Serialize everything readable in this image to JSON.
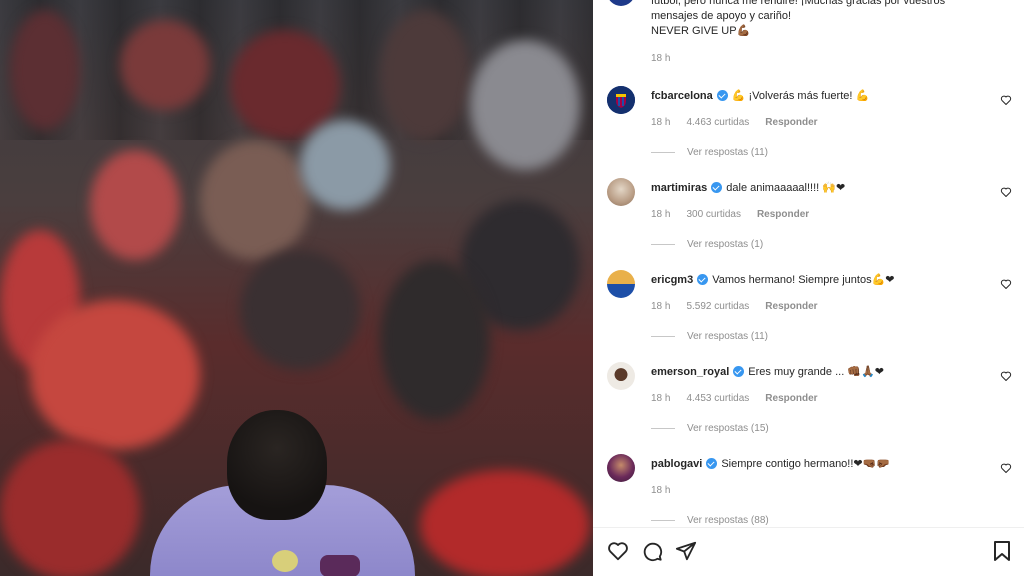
{
  "post": {
    "caption_lines": [
      "fútbol, pero nunca me rendiré! ¡Muchas gracias por vuestros",
      "mensajes de apoyo y cariño!",
      "NEVER GIVE UP💪🏾"
    ],
    "caption_time": "18 h"
  },
  "comments": [
    {
      "user": "fcbarcelona",
      "text": "💪 ¡Volverás más fuerte! 💪",
      "time": "18 h",
      "likes": "4.463 curtidas",
      "reply_label": "Responder",
      "replies": "Ver respostas (11)",
      "avatar_color": "#1a3a8a"
    },
    {
      "user": "martimiras",
      "text": "dale animaaaaal!!!! 🙌❤",
      "time": "18 h",
      "likes": "300 curtidas",
      "reply_label": "Responder",
      "replies": "Ver respostas (1)",
      "avatar_color": "#c9b7a3"
    },
    {
      "user": "ericgm3",
      "text": "Vamos hermano! Siempre juntos💪❤",
      "time": "18 h",
      "likes": "5.592 curtidas",
      "reply_label": "Responder",
      "replies": "Ver respostas (11)",
      "avatar_color": "#1d4fa8"
    },
    {
      "user": "emerson_royal",
      "text": "Eres muy grande ... 👊🏾🙏🏾❤",
      "time": "18 h",
      "likes": "4.453 curtidas",
      "reply_label": "Responder",
      "replies": "Ver respostas (15)",
      "avatar_color": "#d9d2c6"
    },
    {
      "user": "pablogavi",
      "text": "Siempre contigo hermano!!❤🤜🏾🤛🏾",
      "time": "18 h",
      "likes": "",
      "reply_label": "",
      "replies": "Ver respostas (88)",
      "avatar_color": "#6b2a5a"
    }
  ],
  "icons": [
    "heart-icon",
    "comment-icon",
    "share-icon",
    "bookmark-icon",
    "verified-icon"
  ],
  "colors": {
    "verified": "#3897f0",
    "muted_text": "#8e8e8e",
    "text": "#262626"
  }
}
